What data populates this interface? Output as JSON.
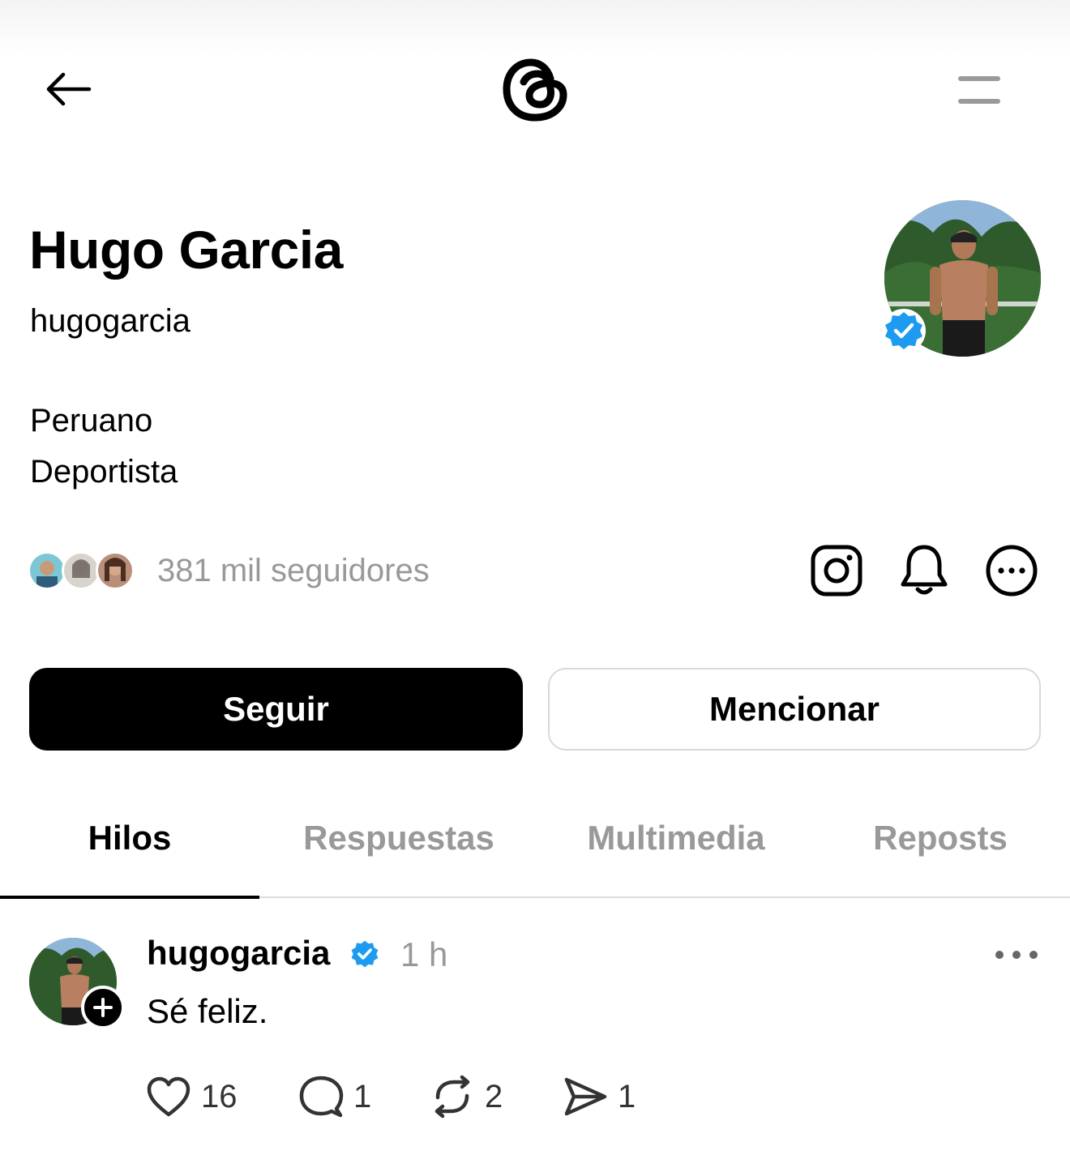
{
  "header": {
    "back_icon": "arrow-left-icon",
    "logo": "threads-logo",
    "menu_icon": "menu-icon"
  },
  "profile": {
    "display_name": "Hugo Garcia",
    "username": "hugogarcia",
    "bio_lines": [
      "Peruano",
      "Deportista"
    ],
    "followers_text": "381 mil seguidores",
    "verified": true
  },
  "profile_actions": {
    "instagram_icon": "instagram-icon",
    "notifications_icon": "bell-icon",
    "more_icon": "more-circle-icon"
  },
  "buttons": {
    "follow": "Seguir",
    "mention": "Mencionar"
  },
  "tabs": [
    {
      "label": "Hilos",
      "active": true
    },
    {
      "label": "Respuestas",
      "active": false
    },
    {
      "label": "Multimedia",
      "active": false
    },
    {
      "label": "Reposts",
      "active": false
    }
  ],
  "post": {
    "username": "hugogarcia",
    "verified": true,
    "time": "1 h",
    "text": "Sé feliz.",
    "likes": "16",
    "replies": "1",
    "reposts": "2",
    "shares": "1"
  },
  "colors": {
    "verified_blue": "#1d9bf0",
    "muted_gray": "#999999",
    "border_gray": "#d9d9d9"
  }
}
